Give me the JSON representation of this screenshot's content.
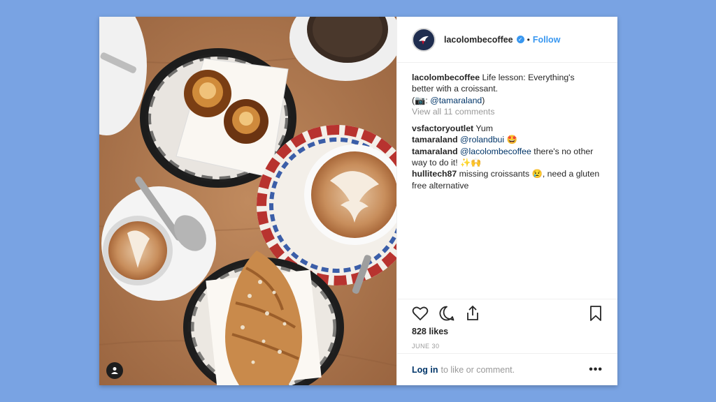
{
  "post": {
    "username": "lacolombecoffee",
    "follow_label": "Follow",
    "separator": "•",
    "caption": {
      "user": "lacolombecoffee",
      "text_line1": " Life lesson: Everything's",
      "text_line2": "better with a croissant.",
      "credit_prefix": "(📷: ",
      "credit_mention": "@tamaraland",
      "credit_suffix": ")",
      "view_all": "View all 11 comments"
    },
    "comments": [
      {
        "user": "vsfactoryoutlet",
        "pre": " Yum",
        "mention": "",
        "post": ""
      },
      {
        "user": "tamaraland",
        "pre": " ",
        "mention": "@rolandbui",
        "post": " 🤩"
      },
      {
        "user": "tamaraland",
        "pre": " ",
        "mention": "@lacolombecoffee",
        "post": " there's no other way to do it! ✨🙌"
      },
      {
        "user": "hullitech87",
        "pre": " missing croissants 😢, need a gluten free alternative",
        "mention": "",
        "post": ""
      }
    ],
    "likes": "828 likes",
    "date": "JUNE 30",
    "login_link": "Log in",
    "login_text": "to like or comment.",
    "more": "•••"
  },
  "icons": {
    "like": "heart-icon",
    "comment": "comment-icon",
    "share": "share-icon",
    "save": "bookmark-icon",
    "user_tag": "user-tag-icon"
  },
  "colors": {
    "background": "#79a3e3",
    "link": "#3897f0",
    "mention": "#003569"
  }
}
